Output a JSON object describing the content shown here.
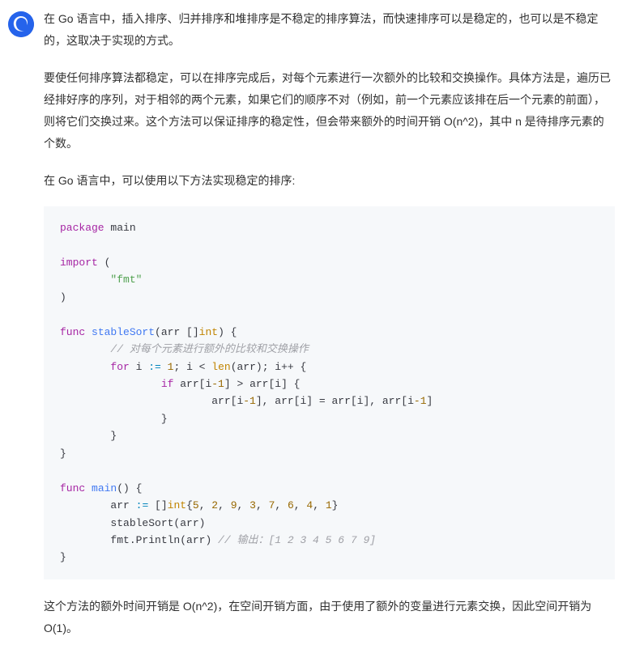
{
  "paragraphs": {
    "p1": "在 Go 语言中，插入排序、归并排序和堆排序是不稳定的排序算法，而快速排序可以是稳定的，也可以是不稳定的，这取决于实现的方式。",
    "p2": "要使任何排序算法都稳定，可以在排序完成后，对每个元素进行一次额外的比较和交换操作。具体方法是，遍历已经排好序的序列，对于相邻的两个元素，如果它们的顺序不对（例如，前一个元素应该排在后一个元素的前面），则将它们交换过来。这个方法可以保证排序的稳定性，但会带来额外的时间开销 O(n^2)，其中 n 是待排序元素的个数。",
    "p3": "在 Go 语言中，可以使用以下方法实现稳定的排序:",
    "p4": "这个方法的额外时间开销是 O(n^2)，在空间开销方面，由于使用了额外的变量进行元素交换，因此空间开销为 O(1)。"
  },
  "code": {
    "t_package": "package",
    "t_main": " main",
    "t_import": "import",
    "t_lparen": " (",
    "t_fmt": "\"fmt\"",
    "t_rparen": ")",
    "t_func": "func",
    "t_stableSort": " stableSort",
    "t_sig1_a": "(arr []",
    "t_int": "int",
    "t_sig1_b": ") {",
    "t_comment1": "// 对每个元素进行额外的比较和交换操作",
    "t_for": "for",
    "t_for_a": " i ",
    "t_assign": ":=",
    "t_sp": " ",
    "t_1": "1",
    "t_for_b": "; i < ",
    "t_len": "len",
    "t_for_c": "(arr); i++ {",
    "t_if": "if",
    "t_if_a": " arr[i",
    "t_minus1": "-1",
    "t_if_b": "] > arr[i] {",
    "t_swap_a": "arr[i",
    "t_swap_b": "], arr[i] = arr[i], arr[i",
    "t_swap_c": "]",
    "t_rbrace": "}",
    "t_mainFn": " main",
    "t_main_sig": "() {",
    "t_arr_a": "arr ",
    "t_arr_b": " []",
    "t_arr_c": "{",
    "t_n5": "5",
    "t_n2": "2",
    "t_n9": "9",
    "t_n3": "3",
    "t_n7": "7",
    "t_n6": "6",
    "t_n4": "4",
    "t_n1": "1",
    "t_comma": ", ",
    "t_arr_d": "}",
    "t_call_sort": "stableSort(arr)",
    "t_print_a": "fmt.Println(arr) ",
    "t_comment2": "// 输出：[1 2 3 4 5 6 7 9]"
  }
}
